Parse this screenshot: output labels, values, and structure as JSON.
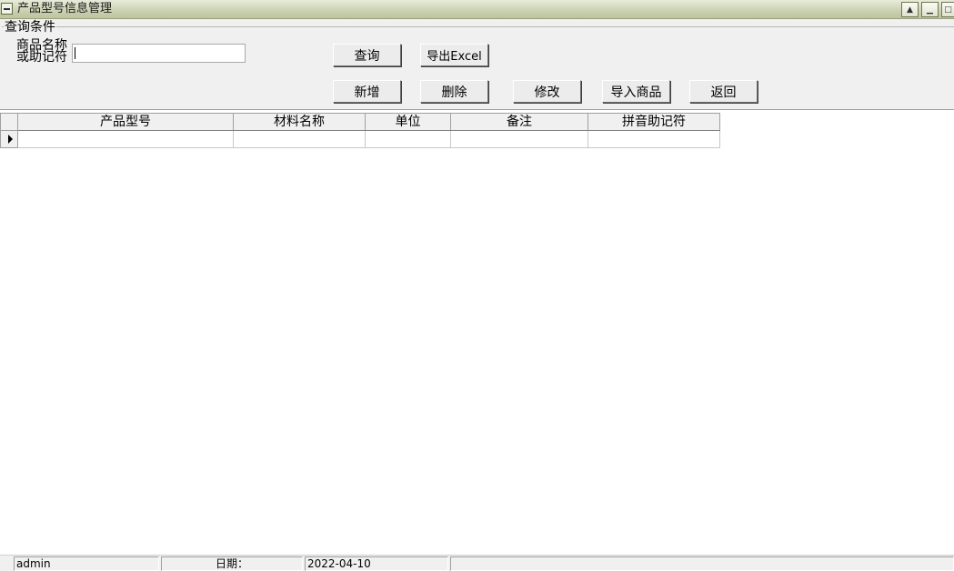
{
  "window": {
    "title": "产品型号信息管理"
  },
  "query": {
    "group_label": "查询条件",
    "field_label_line1": "商品名称",
    "field_label_line2": "或助记符",
    "field_value": "",
    "search_label": "查询",
    "export_label": "导出Excel"
  },
  "actions": {
    "new_label": "新增",
    "delete_label": "删除",
    "edit_label": "修改",
    "import_label": "导入商品",
    "back_label": "返回"
  },
  "grid": {
    "columns": [
      "产品型号",
      "材料名称",
      "单位",
      "备注",
      "拼音助记符"
    ],
    "rows": [
      [
        "",
        "",
        "",
        "",
        ""
      ]
    ]
  },
  "status": {
    "user": "admin",
    "date_label": "日期：",
    "date_value": "2022-04-10",
    "extra": ""
  }
}
